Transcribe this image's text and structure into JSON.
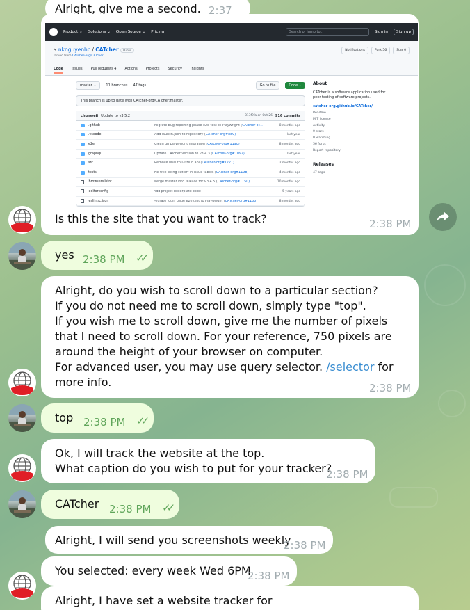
{
  "messages": {
    "m0": {
      "text": "Alright, give me a second.",
      "time": "2:37 PM"
    },
    "m1": {
      "text": "Is this the site that you want to track?",
      "time": "2:38 PM"
    },
    "m2": {
      "text": "yes",
      "time": "2:38 PM"
    },
    "m3": {
      "text": "Alright, do you wish to scroll down to a particular section?\nIf you do not need me to scroll down, simply type \"top\".\nIf you wish me to scroll down, give me the number of pixels that I need to scroll down. For your reference, 750 pixels are around the height of your browser on computer.\nFor advanced user, you may use query selector. ",
      "link": "/selector",
      "after": " for more info.",
      "time": "2:38 PM"
    },
    "m4": {
      "text": "top",
      "time": "2:38 PM"
    },
    "m5": {
      "text": "Ok, I will track the website at the top.\nWhat caption do you wish to put for your tracker?",
      "time": "2:38 PM"
    },
    "m6": {
      "text": "CATcher",
      "time": "2:38 PM"
    },
    "m7": {
      "text": "Alright, I will send you screenshots weekly",
      "time": "2:38 PM"
    },
    "m8": {
      "text": "You selected: every week Wed 6PM",
      "time": "2:38 PM"
    },
    "m9": {
      "text": "Alright, I have set a website tracker for"
    }
  },
  "github": {
    "nav": [
      "Product ⌄",
      "Solutions ⌄",
      "Open Source ⌄",
      "Pricing"
    ],
    "search_placeholder": "Search or jump to...",
    "signin": "Sign in",
    "signup": "Sign up",
    "owner": "nknguyenhc",
    "repo": "CATcher",
    "visibility": "Public",
    "forked_prefix": "forked from ",
    "forked_from": "CATcher-org/CATcher",
    "notifications": "Notifications",
    "fork": "Fork 56",
    "star": "Star 0",
    "tabs": [
      "Code",
      "Issues",
      "Pull requests 4",
      "Actions",
      "Projects",
      "Security",
      "Insights"
    ],
    "branch": "master ⌄",
    "branches": "11 branches",
    "tags": "47 tags",
    "goto_file": "Go to file",
    "code_btn": "Code ⌄",
    "uptodate": "This branch is up to date with CATcher-org/CATcher:master.",
    "commit_author": "chunweii",
    "commit_msg": "Update to v3.5.2",
    "commit_sha": "813f9fa  on Oct 26",
    "commit_count": "916 commits",
    "files": [
      {
        "name": ".github",
        "type": "dir",
        "msg": "Migrate bug reporting phase e2e test to Playwright (",
        "ref": "CATcher-or...",
        "when": "8 months ago"
      },
      {
        "name": ".vscode",
        "type": "dir",
        "msg": "Add launch.json to repository (",
        "ref": "CATcher-org#889)",
        "when": "last year"
      },
      {
        "name": "e2e",
        "type": "dir",
        "msg": "Clean up playwright migration (",
        "ref": "CATcher-org#1190)",
        "when": "8 months ago"
      },
      {
        "name": "graphql",
        "type": "dir",
        "msg": "Update CATcher version to v3.4.3 (",
        "ref": "CATcher-org#1092)",
        "when": "last year"
      },
      {
        "name": "src",
        "type": "dir",
        "msg": "Remove unauth GitHub api (",
        "ref": "CATcher-org#1221)",
        "when": "2 months ago"
      },
      {
        "name": "tests",
        "type": "dir",
        "msg": "Fix title being cut off in issue-tables (",
        "ref": "CATcher-org#1198)",
        "when": "4 months ago"
      },
      {
        "name": ".browserslistrc",
        "type": "file",
        "msg": "Merge master into release for V3.4.5 (",
        "ref": "CATcher-org#1150)",
        "when": "10 months ago"
      },
      {
        "name": ".editorconfig",
        "type": "file",
        "msg": "Add project boilerplate code",
        "ref": "",
        "when": "5 years ago"
      },
      {
        "name": ".eslintrc.json",
        "type": "file",
        "msg": "Migrate login page e2e test to Playwright (",
        "ref": "CATcher-org#1188)",
        "when": "8 months ago"
      }
    ],
    "about_title": "About",
    "about_desc": "CATcher is a software application used for peer-testing of software projects.",
    "about_site": "catcher-org.github.io/CATcher/",
    "about_items": [
      "Readme",
      "MIT license",
      "Activity",
      "0 stars",
      "0 watching",
      "56 forks",
      "Report repository"
    ],
    "releases_title": "Releases",
    "releases_tags": "47 tags"
  }
}
